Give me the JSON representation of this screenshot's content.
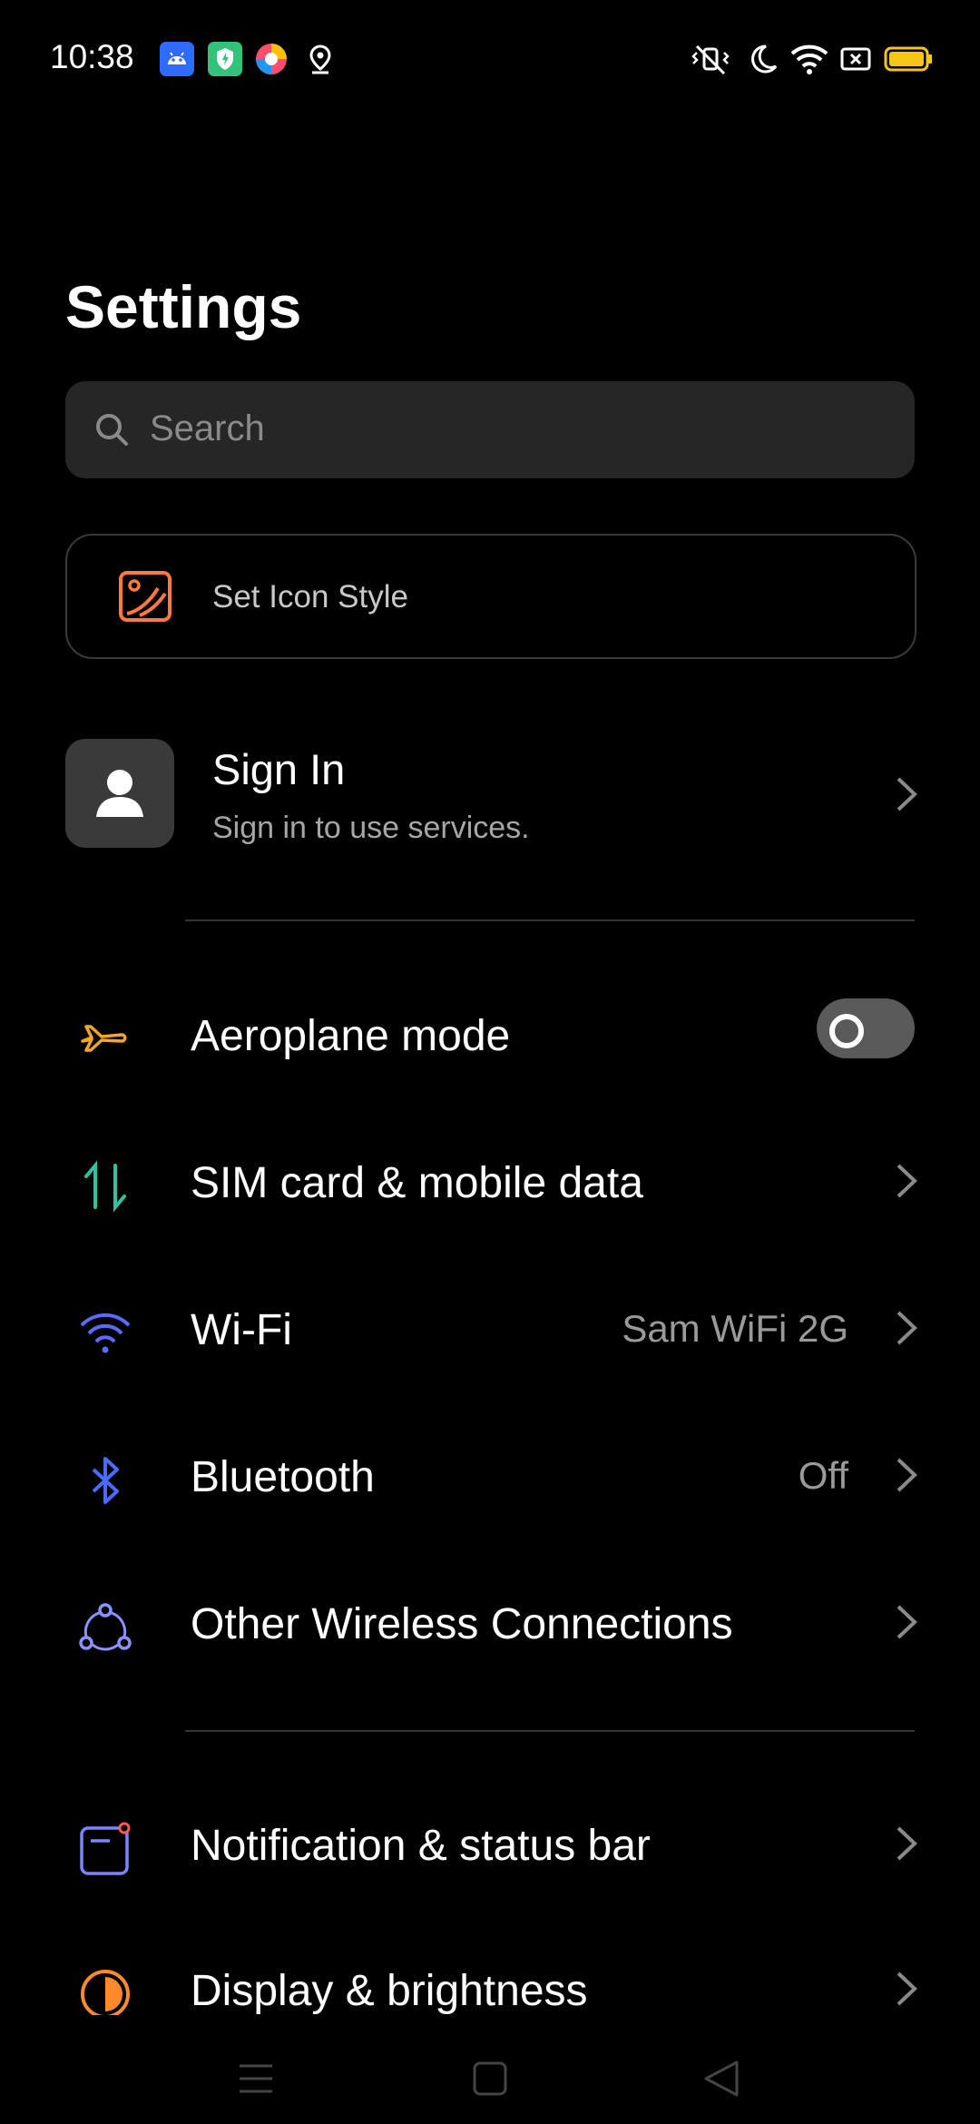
{
  "status_bar": {
    "time": "10:38",
    "left_icons": [
      "android-icon",
      "shield-app-icon",
      "browser-app-icon",
      "location-icon"
    ],
    "right_icons": [
      "vibrate-off-icon",
      "moon-icon",
      "wifi-icon",
      "battery-saver-icon",
      "battery-icon"
    ],
    "battery_color": "#f5c518"
  },
  "page_title": "Settings",
  "search": {
    "placeholder": "Search"
  },
  "icon_style": {
    "label": "Set Icon Style",
    "icon": "image-brush-icon",
    "color": "#ff7a3d"
  },
  "account": {
    "title": "Sign In",
    "subtitle": "Sign in to use services."
  },
  "group1": [
    {
      "label": "Aeroplane mode",
      "icon": "airplane-icon",
      "color": "#f5a623",
      "toggle": false
    },
    {
      "label": "SIM card & mobile data",
      "icon": "mobile-data-icon",
      "color": "#2fc2a0"
    },
    {
      "label": "Wi-Fi",
      "icon": "wifi-icon",
      "color": "#5b6bff",
      "value": "Sam WiFi 2G"
    },
    {
      "label": "Bluetooth",
      "icon": "bluetooth-icon",
      "color": "#4b6bff",
      "value": "Off"
    },
    {
      "label": "Other Wireless Connections",
      "icon": "connections-icon",
      "color": "#8a93ff"
    }
  ],
  "group2": [
    {
      "label": "Notification & status bar",
      "icon": "notification-icon",
      "color": "#7a85ff"
    },
    {
      "label": "Display & brightness",
      "icon": "display-icon",
      "color": "#ff8a2a"
    }
  ],
  "nav_bar": {
    "buttons": [
      "menu-icon",
      "home-icon",
      "back-icon"
    ]
  }
}
